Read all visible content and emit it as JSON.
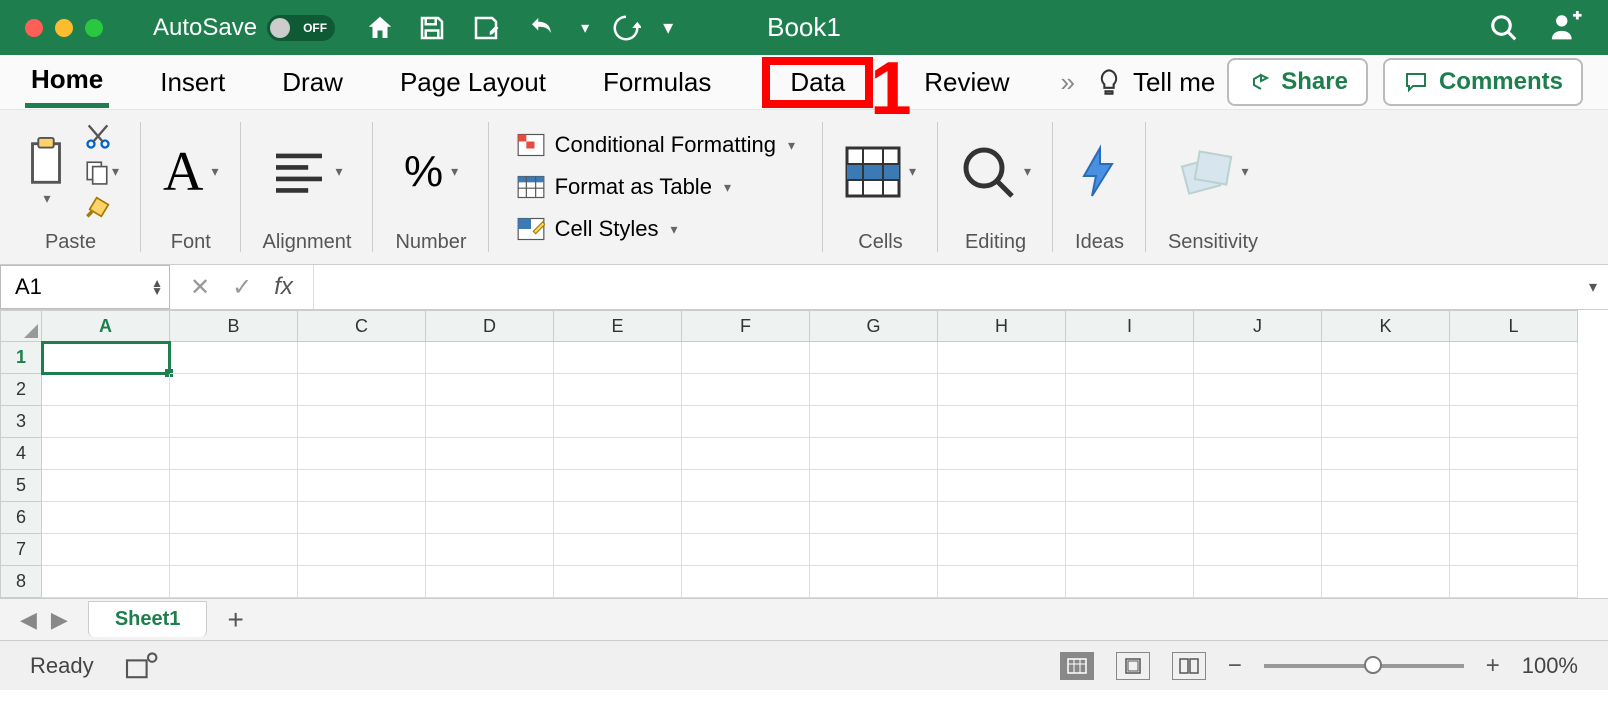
{
  "titlebar": {
    "autosave_label": "AutoSave",
    "autosave_state": "OFF",
    "document_title": "Book1"
  },
  "tabs": {
    "items": [
      "Home",
      "Insert",
      "Draw",
      "Page Layout",
      "Formulas",
      "Data",
      "Review"
    ],
    "active": "Home",
    "highlighted": "Data",
    "tellme": "Tell me",
    "share": "Share",
    "comments": "Comments"
  },
  "annotation": {
    "one": "1"
  },
  "ribbon": {
    "paste": "Paste",
    "font": "Font",
    "alignment": "Alignment",
    "number": "Number",
    "cond_fmt": "Conditional Formatting",
    "format_table": "Format as Table",
    "cell_styles": "Cell Styles",
    "cells": "Cells",
    "editing": "Editing",
    "ideas": "Ideas",
    "sensitivity": "Sensitivity"
  },
  "formula_bar": {
    "name_box": "A1"
  },
  "grid": {
    "columns": [
      "A",
      "B",
      "C",
      "D",
      "E",
      "F",
      "G",
      "H",
      "I",
      "J",
      "K",
      "L"
    ],
    "rows": [
      1,
      2,
      3,
      4,
      5,
      6,
      7,
      8
    ],
    "active_cell": "A1"
  },
  "sheetbar": {
    "active_sheet": "Sheet1"
  },
  "statusbar": {
    "status": "Ready",
    "zoom": "100%"
  }
}
